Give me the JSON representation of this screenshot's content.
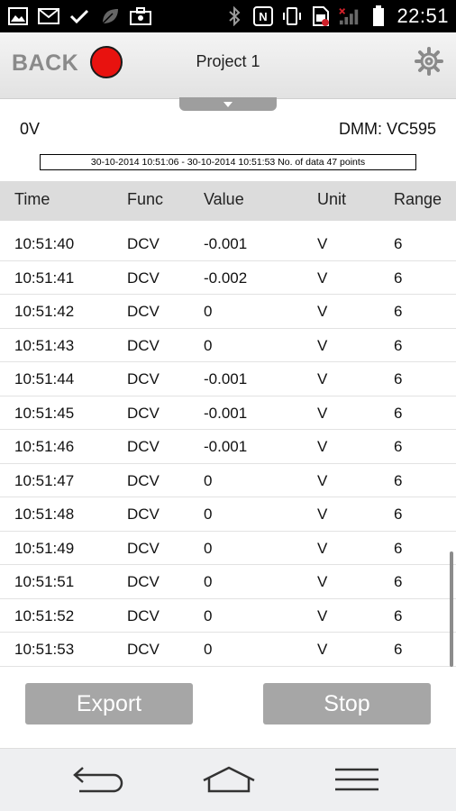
{
  "status_bar": {
    "time": "22:51",
    "left_icons": [
      "image-icon",
      "gmail-icon",
      "check-icon",
      "leaf-icon",
      "briefcase-icon"
    ],
    "right_icons": [
      "bluetooth-icon",
      "nfc-icon",
      "vibrate-icon",
      "sim-icon",
      "signal-icon",
      "battery-icon"
    ]
  },
  "header": {
    "back_label": "BACK",
    "title": "Project 1",
    "record_color": "#e8120f"
  },
  "info": {
    "voltage": "0V",
    "dmm": "DMM: VC595",
    "range_summary": "30-10-2014 10:51:06 - 30-10-2014 10:51:53 No. of data 47 points"
  },
  "table": {
    "columns": [
      "Time",
      "Func",
      "Value",
      "Unit",
      "Range"
    ],
    "rows": [
      [
        "10:51:40",
        "DCV",
        "-0.001",
        "V",
        "6"
      ],
      [
        "10:51:41",
        "DCV",
        "-0.002",
        "V",
        "6"
      ],
      [
        "10:51:42",
        "DCV",
        "0",
        "V",
        "6"
      ],
      [
        "10:51:43",
        "DCV",
        "0",
        "V",
        "6"
      ],
      [
        "10:51:44",
        "DCV",
        "-0.001",
        "V",
        "6"
      ],
      [
        "10:51:45",
        "DCV",
        "-0.001",
        "V",
        "6"
      ],
      [
        "10:51:46",
        "DCV",
        "-0.001",
        "V",
        "6"
      ],
      [
        "10:51:47",
        "DCV",
        "0",
        "V",
        "6"
      ],
      [
        "10:51:48",
        "DCV",
        "0",
        "V",
        "6"
      ],
      [
        "10:51:49",
        "DCV",
        "0",
        "V",
        "6"
      ],
      [
        "10:51:51",
        "DCV",
        "0",
        "V",
        "6"
      ],
      [
        "10:51:52",
        "DCV",
        "0",
        "V",
        "6"
      ],
      [
        "10:51:53",
        "DCV",
        "0",
        "V",
        "6"
      ]
    ]
  },
  "buttons": {
    "export_label": "Export",
    "stop_label": "Stop"
  },
  "nav": {
    "icons": [
      "back-icon",
      "home-icon",
      "menu-icon"
    ]
  },
  "colors": {
    "header_text": "#8a8a8a",
    "button_bg": "#a6a6a6",
    "table_header_bg": "#dcdcdc"
  }
}
